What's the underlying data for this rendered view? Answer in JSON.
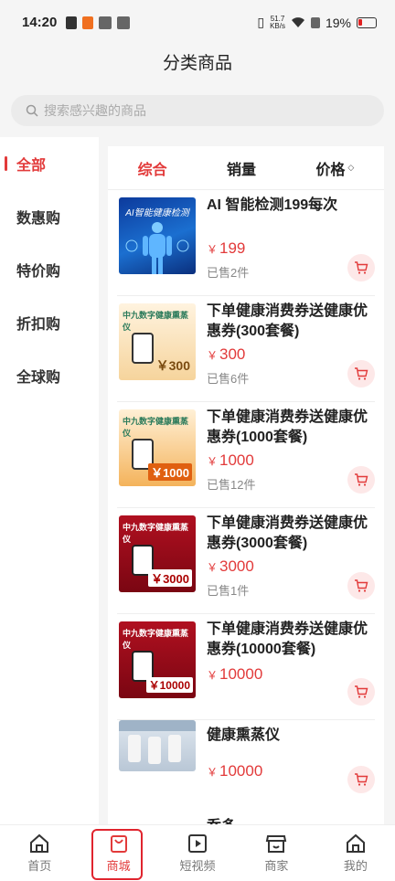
{
  "status_bar": {
    "time": "14:20",
    "speed_value": "51.7",
    "speed_unit": "KB/s",
    "battery": "19%"
  },
  "header": {
    "title": "分类商品"
  },
  "search": {
    "placeholder": "搜索感兴趣的商品"
  },
  "sidebar": {
    "items": [
      {
        "label": "全部",
        "active": true
      },
      {
        "label": "数惠购",
        "active": false
      },
      {
        "label": "特价购",
        "active": false
      },
      {
        "label": "折扣购",
        "active": false
      },
      {
        "label": "全球购",
        "active": false
      }
    ]
  },
  "sort": {
    "items": [
      {
        "label": "综合",
        "active": true
      },
      {
        "label": "销量",
        "active": false
      },
      {
        "label": "价格",
        "active": false
      }
    ],
    "price_arrows": "◇"
  },
  "products": [
    {
      "name": "AI 智能检测199每次",
      "currency": "￥",
      "price": "199",
      "sold": "已售2件",
      "image_text": "AI智能健康检测",
      "image_style": "blue"
    },
    {
      "name": "下单健康消费券送健康优惠券(300套餐)",
      "currency": "￥",
      "price": "300",
      "sold": "已售6件",
      "image_brand": "中九数字健康熏蒸仪",
      "image_price": "￥300",
      "image_style": "cream"
    },
    {
      "name": "下单健康消费券送健康优惠券(1000套餐)",
      "currency": "￥",
      "price": "1000",
      "sold": "已售12件",
      "image_brand": "中九数字健康熏蒸仪",
      "image_price": "￥1000",
      "image_style": "orange"
    },
    {
      "name": "下单健康消费券送健康优惠券(3000套餐)",
      "currency": "￥",
      "price": "3000",
      "sold": "已售1件",
      "image_brand": "中九数字健康熏蒸仪",
      "image_price": "￥3000",
      "image_style": "red"
    },
    {
      "name": "下单健康消费券送健康优惠券(10000套餐)",
      "currency": "￥",
      "price": "10000",
      "sold": "",
      "image_brand": "中九数字健康熏蒸仪",
      "image_price": "￥10000",
      "image_style": "red"
    },
    {
      "name": "健康熏蒸仪",
      "currency": "￥",
      "price": "10000",
      "sold": "",
      "image_style": "photo"
    }
  ],
  "partial_next_item": "乔多",
  "tabbar": {
    "items": [
      {
        "label": "首页",
        "icon": "home-icon",
        "active": false
      },
      {
        "label": "商城",
        "icon": "shopping-bag-icon",
        "active": true
      },
      {
        "label": "短视频",
        "icon": "video-play-icon",
        "active": false
      },
      {
        "label": "商家",
        "icon": "store-icon",
        "active": false
      },
      {
        "label": "我的",
        "icon": "profile-home-icon",
        "active": false
      }
    ]
  },
  "colors": {
    "accent": "#e23a3a",
    "highlight_box": "#e0242e"
  }
}
